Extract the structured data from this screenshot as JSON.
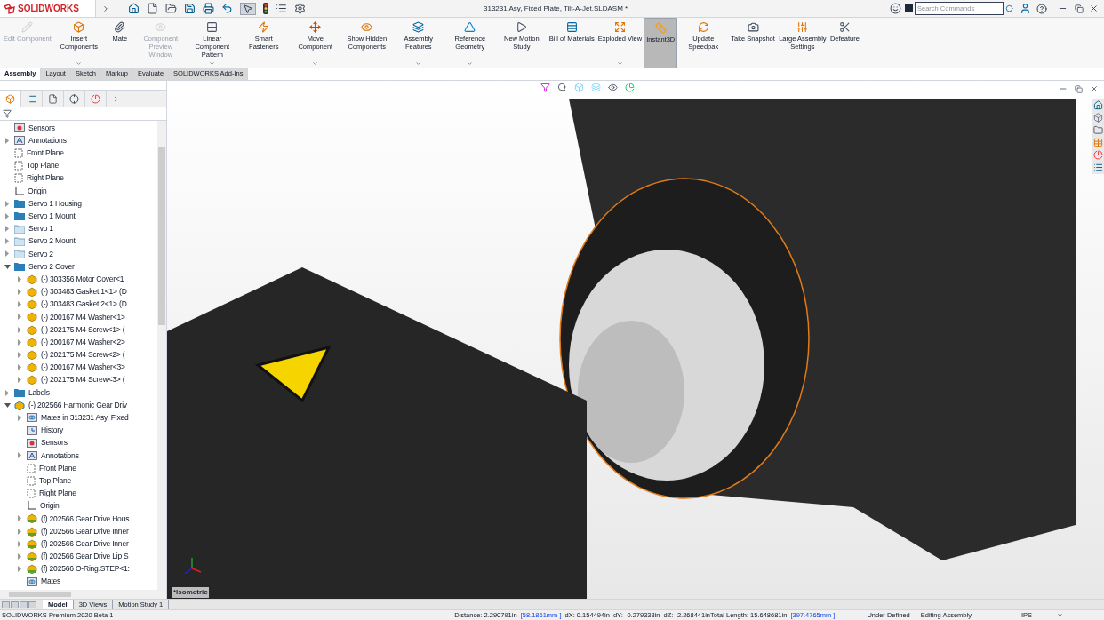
{
  "title_bar": {
    "logo": "SOLIDWORKS",
    "title": "313231 Asy, Fixed Plate, Tilt-A-Jet.SLDASM *",
    "search_placeholder": "Search Commands"
  },
  "ribbon": [
    {
      "label": "Edit Component",
      "disabled": true,
      "dropdown": false,
      "selected": false
    },
    {
      "label": "Insert Components",
      "disabled": false,
      "dropdown": true,
      "selected": false
    },
    {
      "label": "Mate",
      "disabled": false,
      "dropdown": false,
      "selected": false
    },
    {
      "label": "Component Preview Window",
      "disabled": true,
      "dropdown": false,
      "selected": false
    },
    {
      "label": "Linear Component Pattern",
      "disabled": false,
      "dropdown": true,
      "selected": false
    },
    {
      "label": "Smart Fasteners",
      "disabled": false,
      "dropdown": false,
      "selected": false
    },
    {
      "label": "Move Component",
      "disabled": false,
      "dropdown": true,
      "selected": false
    },
    {
      "label": "Show Hidden Components",
      "disabled": false,
      "dropdown": false,
      "selected": false
    },
    {
      "label": "Assembly Features",
      "disabled": false,
      "dropdown": true,
      "selected": false
    },
    {
      "label": "Reference Geometry",
      "disabled": false,
      "dropdown": true,
      "selected": false
    },
    {
      "label": "New Motion Study",
      "disabled": false,
      "dropdown": false,
      "selected": false
    },
    {
      "label": "Bill of Materials",
      "disabled": false,
      "dropdown": false,
      "selected": false
    },
    {
      "label": "Exploded View",
      "disabled": false,
      "dropdown": true,
      "selected": false
    },
    {
      "label": "Instant3D",
      "disabled": false,
      "dropdown": false,
      "selected": true
    },
    {
      "label": "Update Speedpak",
      "disabled": false,
      "dropdown": false,
      "selected": false
    },
    {
      "label": "Take Snapshot",
      "disabled": false,
      "dropdown": false,
      "selected": false
    },
    {
      "label": "Large Assembly Settings",
      "disabled": false,
      "dropdown": false,
      "selected": false
    },
    {
      "label": "Defeature",
      "disabled": false,
      "dropdown": false,
      "selected": false
    }
  ],
  "command_tabs": [
    {
      "label": "Assembly",
      "selected": true
    },
    {
      "label": "Layout",
      "selected": false
    },
    {
      "label": "Sketch",
      "selected": false
    },
    {
      "label": "Markup",
      "selected": false
    },
    {
      "label": "Evaluate",
      "selected": false
    },
    {
      "label": "SOLIDWORKS Add-Ins",
      "selected": false
    }
  ],
  "tree": [
    {
      "label": "Sensors",
      "kind": "sensors"
    },
    {
      "label": "Annotations",
      "kind": "annotations",
      "expandable": true,
      "expanded": false
    },
    {
      "label": "Front Plane",
      "kind": "plane"
    },
    {
      "label": "Top Plane",
      "kind": "plane"
    },
    {
      "label": "Right Plane",
      "kind": "plane"
    },
    {
      "label": "Origin",
      "kind": "origin"
    },
    {
      "label": "Servo 1 Housing",
      "kind": "folder",
      "expandable": true,
      "expanded": false
    },
    {
      "label": "Servo 1 Mount",
      "kind": "folder",
      "expandable": true,
      "expanded": false
    },
    {
      "label": "Servo 1",
      "kind": "empty-folder",
      "expandable": true,
      "expanded": false
    },
    {
      "label": "Servo 2 Mount",
      "kind": "empty-folder",
      "expandable": true,
      "expanded": false
    },
    {
      "label": "Servo 2",
      "kind": "empty-folder",
      "expandable": true,
      "expanded": false
    },
    {
      "label": "Servo 2 Cover",
      "kind": "folder",
      "expandable": true,
      "expanded": true,
      "children": [
        {
          "label": "(-) 303356 Motor Cover<1",
          "kind": "part",
          "expandable": true,
          "expanded": false
        },
        {
          "label": "(-) 303483 Gasket 1<1> (D",
          "kind": "part",
          "expandable": true,
          "expanded": false
        },
        {
          "label": "(-) 303483 Gasket 2<1> (D",
          "kind": "part",
          "expandable": true,
          "expanded": false
        },
        {
          "label": "(-) 200167 M4 Washer<1>",
          "kind": "part",
          "expandable": true,
          "expanded": false
        },
        {
          "label": "(-) 202175 M4 Screw<1> (",
          "kind": "part",
          "expandable": true,
          "expanded": false
        },
        {
          "label": "(-) 200167 M4 Washer<2>",
          "kind": "part",
          "expandable": true,
          "expanded": false
        },
        {
          "label": "(-) 202175 M4 Screw<2> (",
          "kind": "part",
          "expandable": true,
          "expanded": false
        },
        {
          "label": "(-) 200167 M4 Washer<3>",
          "kind": "part",
          "expandable": true,
          "expanded": false
        },
        {
          "label": "(-) 202175 M4 Screw<3> (",
          "kind": "part",
          "expandable": true,
          "expanded": false
        }
      ]
    },
    {
      "label": "Labels",
      "kind": "folder",
      "expandable": true,
      "expanded": false
    },
    {
      "label": "(-) 202566 Harmonic Gear Driv",
      "kind": "assembly",
      "expandable": true,
      "expanded": true,
      "children": [
        {
          "label": "Mates in 313231 Asy, Fixed",
          "kind": "mates",
          "expandable": true,
          "expanded": false
        },
        {
          "label": "History",
          "kind": "history"
        },
        {
          "label": "Sensors",
          "kind": "sensors"
        },
        {
          "label": "Annotations",
          "kind": "annotations",
          "expandable": true,
          "expanded": false
        },
        {
          "label": "Front Plane",
          "kind": "plane"
        },
        {
          "label": "Top Plane",
          "kind": "plane"
        },
        {
          "label": "Right Plane",
          "kind": "plane"
        },
        {
          "label": "Origin",
          "kind": "origin"
        },
        {
          "label": "(f) 202566 Gear Drive Hous",
          "kind": "fixed-part",
          "expandable": true,
          "expanded": false
        },
        {
          "label": "(f) 202566 Gear Drive Inner",
          "kind": "fixed-part",
          "expandable": true,
          "expanded": false
        },
        {
          "label": "(f) 202566 Gear Drive Inner",
          "kind": "fixed-part",
          "expandable": true,
          "expanded": false
        },
        {
          "label": "(f) 202566 Gear Drive Lip S",
          "kind": "fixed-part",
          "expandable": true,
          "expanded": false
        },
        {
          "label": "(f) 202566 O-Ring.STEP<1:",
          "kind": "fixed-part",
          "expandable": true,
          "expanded": false
        },
        {
          "label": "Mates",
          "kind": "mates"
        }
      ]
    }
  ],
  "viewport": {
    "view_label": "*Isometric"
  },
  "bottom_tabs": [
    {
      "label": "Model",
      "selected": true
    },
    {
      "label": "3D Views",
      "selected": false
    },
    {
      "label": "Motion Study 1",
      "selected": false
    }
  ],
  "status_bar": {
    "product": "SOLIDWORKS Premium 2020 Beta 1",
    "measurements": [
      {
        "text": "Distance: 2.290791in",
        "metric": false
      },
      {
        "text": "[58.1861mm ]",
        "metric": true
      },
      {
        "text": "dX: 0.154494in",
        "metric": false
      },
      {
        "text": "dY: -0.279338in",
        "metric": false
      },
      {
        "text": "dZ: -2.268441inTotal Length: 15.648681in",
        "metric": false
      },
      {
        "text": "[397.4765mm ]",
        "metric": true
      }
    ],
    "state": "Under Defined",
    "mode": "Editing Assembly",
    "units": "IPS"
  }
}
